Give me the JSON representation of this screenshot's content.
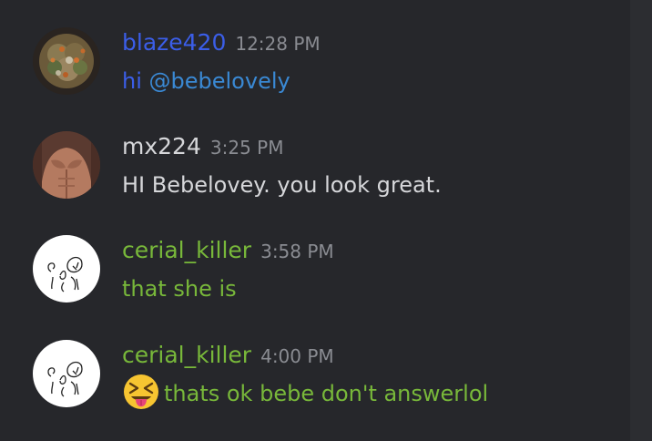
{
  "colors": {
    "background": "#26272b",
    "blaze_user": "#3b5ee8",
    "mention": "#3a89d4",
    "cerial_user": "#78b83a",
    "default_text": "#d6d7da",
    "timestamp": "#8a8c92"
  },
  "messages": [
    {
      "username": "blaze420",
      "time": "12:28 PM",
      "text_prefix": "hi ",
      "mention": "@bebelovely",
      "avatar_icon": "cannabis-bud-avatar"
    },
    {
      "username": "mx224",
      "time": "3:25 PM",
      "text": "HI Bebelovey. you look great.",
      "avatar_icon": "shirtless-torso-avatar"
    },
    {
      "username": "cerial_killer",
      "time": "3:58 PM",
      "text": "that she is",
      "avatar_icon": "doodle-face-avatar"
    },
    {
      "username": "cerial_killer",
      "time": "4:00 PM",
      "text": "thats ok bebe don't answerlol",
      "emoji": "squinting-face-with-tongue-icon",
      "avatar_icon": "doodle-face-avatar"
    }
  ]
}
